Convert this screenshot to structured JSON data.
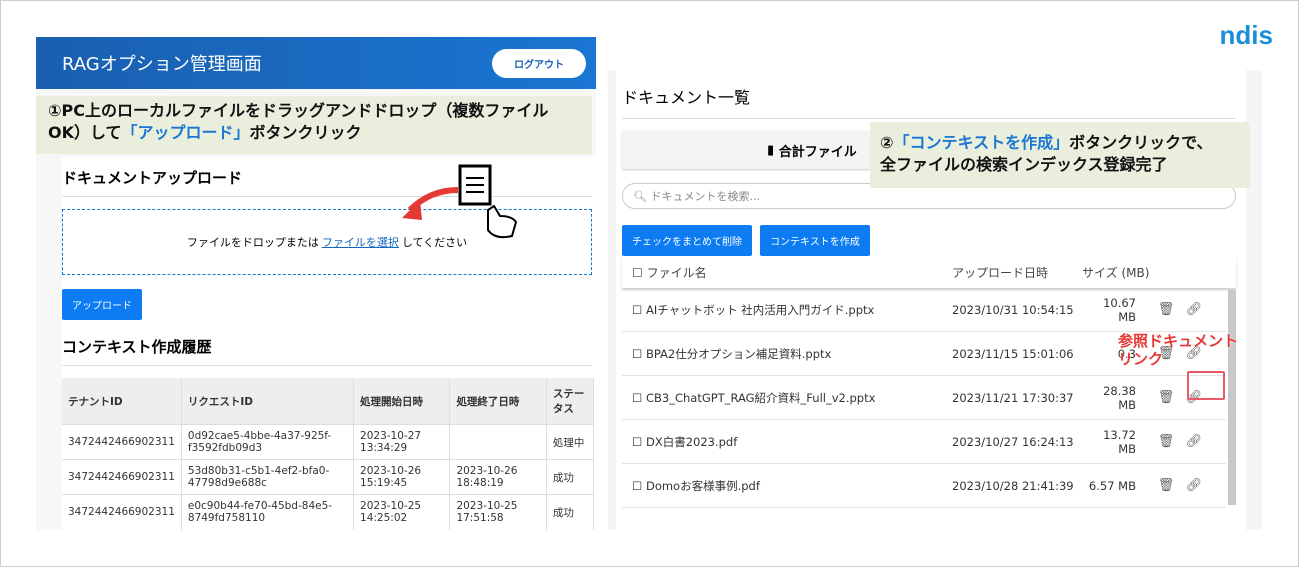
{
  "brand": "ndis",
  "left": {
    "header_title": "RAGオプション管理画面",
    "logout": "ログアウト",
    "upload_title": "ドキュメントアップロード",
    "drop_before": "ファイルをドロップまたは",
    "drop_link": "ファイルを選択",
    "drop_after": "してください",
    "upload_button": "アップロード",
    "history_title": "コンテキスト作成履歴",
    "columns": [
      "テナントID",
      "リクエストID",
      "処理開始日時",
      "処理終了日時",
      "ステータス"
    ],
    "rows": [
      [
        "3472442466902311",
        "0d92cae5-4bbe-4a37-925f-f3592fdb09d3",
        "2023-10-27 13:34:29",
        "",
        "処理中"
      ],
      [
        "3472442466902311",
        "53d80b31-c5b1-4ef2-bfa0-47798d9e688c",
        "2023-10-26 15:19:45",
        "2023-10-26 18:48:19",
        "成功"
      ],
      [
        "3472442466902311",
        "e0c90b44-fe70-45bd-84e5-8749fd758110",
        "2023-10-25 14:25:02",
        "2023-10-25 17:51:58",
        "成功"
      ]
    ]
  },
  "annotation1": {
    "a": "①PC上のローカルファイルをドラッグアンドドロップ（複数ファイルOK）して",
    "hl": "「アップロード」",
    "b": "ボタンクリック"
  },
  "annotation2": {
    "a": "②",
    "hl": "「コンテキストを作成」",
    "b": "ボタンクリックで、",
    "c": "全ファイルの検索インデックス登録完了"
  },
  "annotation3": "参照ドキュメント\nリンク",
  "right": {
    "title": "ドキュメント一覧",
    "summary": "合計ファイル",
    "search_placeholder": "ドキュメントを検索...",
    "delete_checked": "チェックをまとめて削除",
    "create_context": "コンテキストを作成",
    "columns": [
      "ファイル名",
      "アップロード日時",
      "サイズ (MB)"
    ],
    "files": [
      [
        "AIチャットボット 社内活用入門ガイド.pptx",
        "2023/10/31 10:54:15",
        "10.67 MB"
      ],
      [
        "BPA2仕分オプション補足資料.pptx",
        "2023/11/15 15:01:06",
        "0.3"
      ],
      [
        "CB3_ChatGPT_RAG紹介資料_Full_v2.pptx",
        "2023/11/21 17:30:37",
        "28.38 MB"
      ],
      [
        "DX白書2023.pdf",
        "2023/10/27 16:24:13",
        "13.72 MB"
      ],
      [
        "Domoお客様事例.pdf",
        "2023/10/28 21:41:39",
        "6.57 MB"
      ]
    ]
  }
}
